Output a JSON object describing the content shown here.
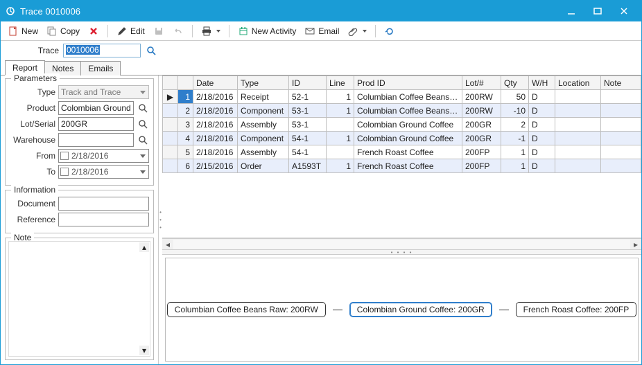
{
  "window": {
    "title": "Trace 0010006"
  },
  "toolbar": {
    "new_label": "New",
    "copy_label": "Copy",
    "edit_label": "Edit",
    "new_activity_label": "New Activity",
    "email_label": "Email"
  },
  "trace": {
    "label": "Trace",
    "value": "0010006"
  },
  "tabs": [
    "Report",
    "Notes",
    "Emails"
  ],
  "parameters": {
    "legend": "Parameters",
    "type_label": "Type",
    "type_value": "Track and Trace",
    "product_label": "Product",
    "product_value": "Colombian Ground Coff",
    "lotserial_label": "Lot/Serial",
    "lotserial_value": "200GR",
    "warehouse_label": "Warehouse",
    "warehouse_value": "",
    "from_label": "From",
    "from_value": "2/18/2016",
    "to_label": "To",
    "to_value": "2/18/2016"
  },
  "information": {
    "legend": "Information",
    "document_label": "Document",
    "document_value": "",
    "reference_label": "Reference",
    "reference_value": ""
  },
  "note": {
    "legend": "Note"
  },
  "grid": {
    "columns": [
      "",
      "",
      "Date",
      "Type",
      "ID",
      "Line",
      "Prod ID",
      "Lot/#",
      "Qty",
      "W/H",
      "Location",
      "Note"
    ],
    "rows": [
      {
        "n": "1",
        "date": "2/18/2016",
        "type": "Receipt",
        "id": "52-1",
        "line": "1",
        "prod": "Columbian Coffee Beans Raw",
        "lot": "200RW",
        "qty": "50",
        "wh": "D",
        "loc": "",
        "note": ""
      },
      {
        "n": "2",
        "date": "2/18/2016",
        "type": "Component",
        "id": "53-1",
        "line": "1",
        "prod": "Columbian Coffee Beans Raw",
        "lot": "200RW",
        "qty": "-10",
        "wh": "D",
        "loc": "",
        "note": ""
      },
      {
        "n": "3",
        "date": "2/18/2016",
        "type": "Assembly",
        "id": "53-1",
        "line": "",
        "prod": "Colombian Ground Coffee",
        "lot": "200GR",
        "qty": "2",
        "wh": "D",
        "loc": "",
        "note": ""
      },
      {
        "n": "4",
        "date": "2/18/2016",
        "type": "Component",
        "id": "54-1",
        "line": "1",
        "prod": "Colombian Ground Coffee",
        "lot": "200GR",
        "qty": "-1",
        "wh": "D",
        "loc": "",
        "note": ""
      },
      {
        "n": "5",
        "date": "2/18/2016",
        "type": "Assembly",
        "id": "54-1",
        "line": "",
        "prod": "French Roast Coffee",
        "lot": "200FP",
        "qty": "1",
        "wh": "D",
        "loc": "",
        "note": ""
      },
      {
        "n": "6",
        "date": "2/15/2016",
        "type": "Order",
        "id": "A1593T",
        "line": "1",
        "prod": "French Roast Coffee",
        "lot": "200FP",
        "qty": "1",
        "wh": "D",
        "loc": "",
        "note": ""
      }
    ]
  },
  "diagram": {
    "nodes": [
      "Columbian Coffee Beans Raw: 200RW",
      "Colombian Ground Coffee: 200GR",
      "French Roast Coffee: 200FP"
    ],
    "selected_index": 1
  }
}
